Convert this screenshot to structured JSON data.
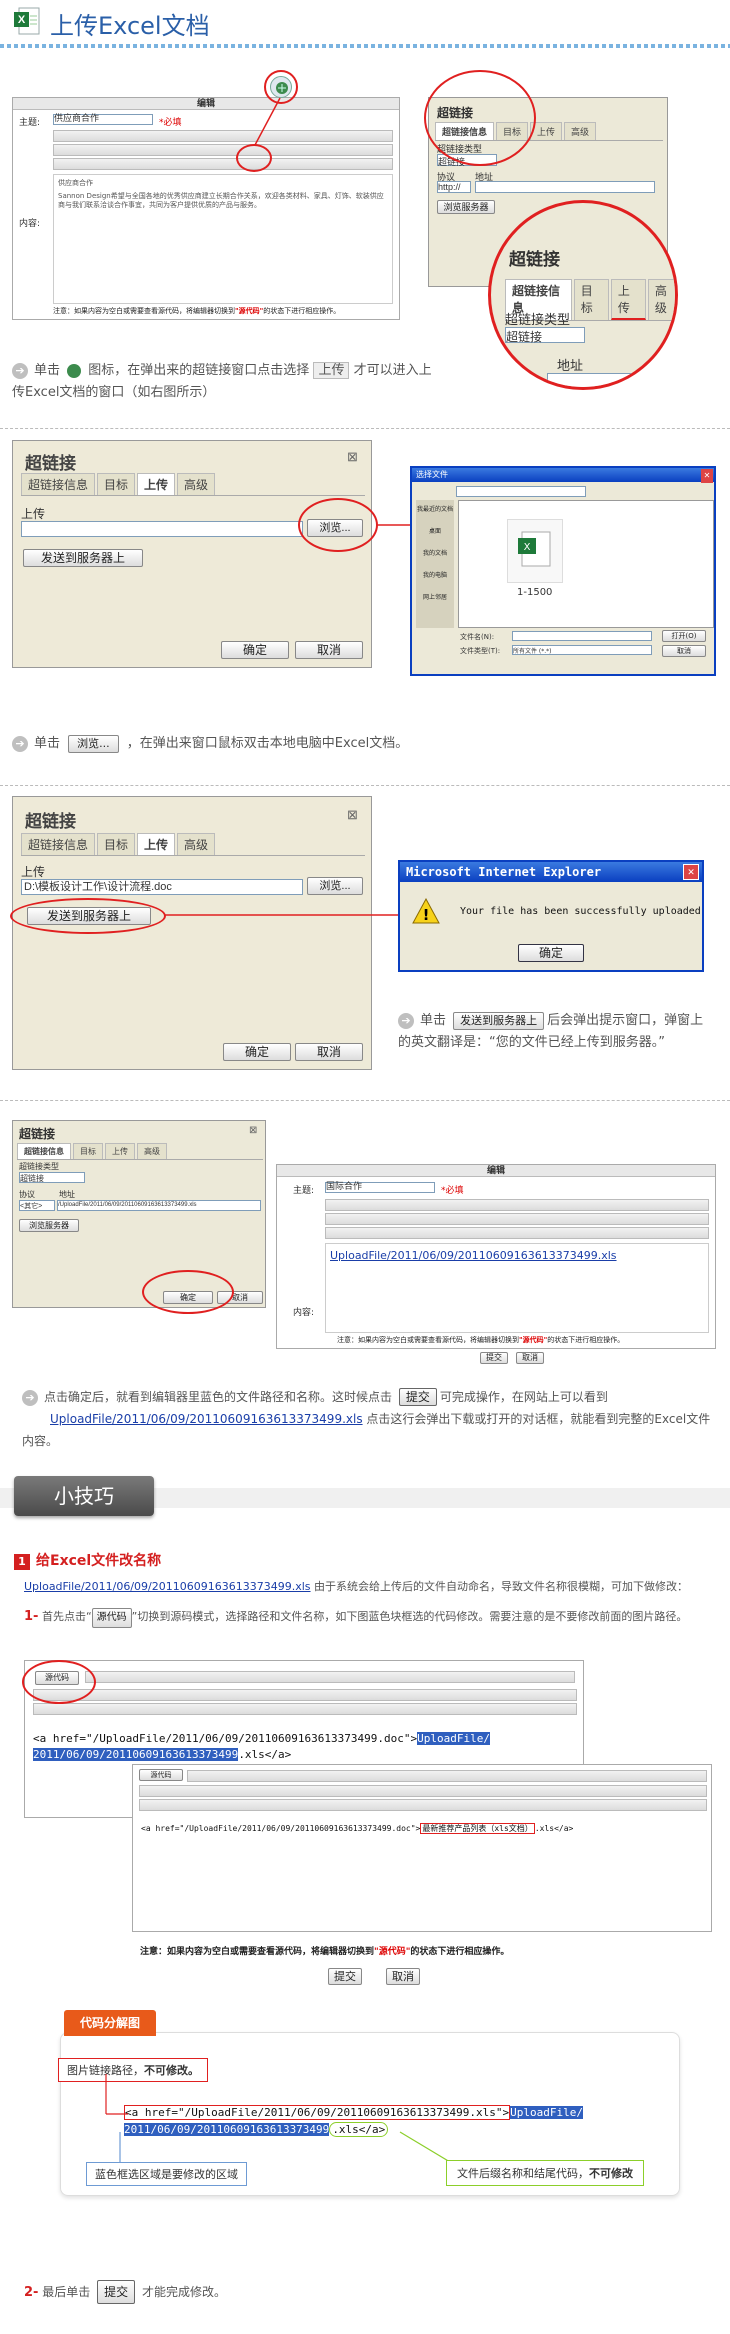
{
  "header": {
    "title": "上传Excel文档"
  },
  "step1": {
    "editor_title": "编辑",
    "subject_label": "主题:",
    "subject_value": "供应商合作",
    "required": "*必填",
    "content_label": "内容:",
    "body_title": "供应商合作",
    "body_text": "Sannon Design希望与全国各地的优秀供应商建立长期合作关系，欢迎各类材料、家具、灯饰、软装供应商与我们联系洽谈合作事宜，共同为客户提供优质的产品与服务。",
    "notice_prefix": "注意：如果内容为空白或需要查看源代码，将编辑器切换到",
    "notice_code": "\"源代码\"",
    "notice_suffix": "的状态下进行相应操作。",
    "hyperlink_title": "超链接",
    "tabs": [
      "超链接信息",
      "目标",
      "上传",
      "高级"
    ],
    "link_type_label": "超链接类型",
    "link_type_value": "超链接",
    "protocol_label": "协议",
    "protocol_value": "http://",
    "address_label": "地址",
    "browse_server": "浏览服务器",
    "desc_before": "单击",
    "desc_mid": "图标，在弹出来的超链接窗口点击选择",
    "desc_upload": "上传",
    "desc_after": "才可以进入上传Excel文档的窗口（如右图所示）"
  },
  "step2": {
    "title": "超链接",
    "tabs": [
      "超链接信息",
      "目标",
      "上传",
      "高级"
    ],
    "upload_label": "上传",
    "browse": "浏览...",
    "send": "发送到服务器上",
    "ok": "确定",
    "cancel": "取消",
    "file_dialog_title": "选择文件",
    "places": [
      "我最近的文档",
      "桌面",
      "我的文档",
      "我的电脑",
      "网上邻居"
    ],
    "file_name": "1-1500",
    "filename_label": "文件名(N):",
    "filetype_label": "文件类型(T):",
    "filetype_value": "所有文件 (*.*)",
    "open_btn": "打开(O)",
    "cancel_btn": "取消",
    "desc_before": "单击",
    "desc_btn": "浏览...",
    "desc_after": "，在弹出来窗口鼠标双击本地电脑中Excel文档。"
  },
  "step3": {
    "title": "超链接",
    "tabs": [
      "超链接信息",
      "目标",
      "上传",
      "高级"
    ],
    "upload_label": "上传",
    "path_value": "D:\\模板设计工作\\设计流程.doc",
    "browse": "浏览...",
    "send": "发送到服务器上",
    "ok": "确定",
    "cancel": "取消",
    "ie_title": "Microsoft Internet Explorer",
    "ie_message": "Your file has been successfully uploaded",
    "ie_ok": "确定",
    "desc_before": "单击",
    "desc_btn": "发送到服务器上",
    "desc_after": "后会弹出提示窗口，弹窗上的英文翻译是：“您的文件已经上传到服务器。”"
  },
  "step4": {
    "title": "超链接",
    "tabs": [
      "超链接信息",
      "目标",
      "上传",
      "高级"
    ],
    "link_type_label": "超链接类型",
    "link_type_value": "超链接",
    "protocol_label": "协议",
    "protocol_value": "<其它>",
    "address_label": "地址",
    "address_value": "/UploadFile/2011/06/09/20110609163613373499.xls",
    "browse_server": "浏览服务器",
    "ok": "确定",
    "cancel": "取消",
    "editor_title": "编辑",
    "subject_label": "主题:",
    "subject_value": "国际合作",
    "required": "*必填",
    "content_label": "内容:",
    "editor_link": "UploadFile/2011/06/09/20110609163613373499.xls",
    "notice_prefix": "注意：如果内容为空白或需要查看源代码，将编辑器切换到",
    "notice_code": "\"源代码\"",
    "notice_suffix": "的状态下进行相应操作。",
    "submit": "提交",
    "cancel2": "取消",
    "desc_1": "点击确定后，就看到编辑器里蓝色的文件路径和名称。这时候点击",
    "desc_submit": "提交",
    "desc_2": "可完成操作，在网站上可以看到",
    "desc_link": "UploadFile/2011/06/09/20110609163613373499.xls",
    "desc_3": "点击这行会弹出下载或打开的对话框，就能看到完整的Excel文件内容。"
  },
  "tips": {
    "banner": "小技巧",
    "num": "1",
    "heading": "给Excel文件改名称",
    "intro_link": "UploadFile/2011/06/09/20110609163613373499.xls",
    "intro_text": "由于系统会给上传后的文件自动命名，导致文件名称很模糊，可加下做修改：",
    "step1_num": "1-",
    "step1_a": "首先点击“",
    "step1_btn": "源代码",
    "step1_b": "”切换到源码模式，选择路径和文件名称，如下图蓝色块框选的代码修改。需要注意的是不要修改前面的图片路径。",
    "code_btn": "源代码",
    "code_line1_a": "<a href=\"/UploadFile/2011/06/09/20110609163613373499.doc\">",
    "code_line1_hl": "UploadFile/",
    "code_line2_hl": "2011/06/09/20110609163613373499",
    "code_line2_b": ".xls</a>",
    "code2_a": "<a href=\"/UploadFile/2011/06/09/20110609163613373499.doc\">",
    "code2_box": "最新推荐产品列表（xls文档）",
    "code2_b": ".xls</a>",
    "notice_prefix": "注意：如果内容为空白或需要查看源代码，将编辑器切换到",
    "notice_code": "\"源代码\"",
    "notice_suffix": "的状态下进行相应操作。",
    "submit": "提交",
    "cancel": "取消",
    "analysis_tab": "代码分解图",
    "img_path_note": "图片链接路径，",
    "img_path_bold": "不可修改。",
    "an_code_a": "<a href=\"/UploadFile/2011/06/09/20110609163613373499.xls\">",
    "an_code_hl1": "UploadFile/",
    "an_code_hl2": "2011/06/09/20110609163613373499",
    "an_code_b": ".xls</a>",
    "blue_note": "蓝色框选区域是要修改的区域",
    "suffix_note": "文件后缀名称和结尾代码，",
    "suffix_bold": "不可修改",
    "step2_num": "2-",
    "step2_a": "最后单击",
    "step2_btn": "提交",
    "step2_b": "才能完成修改。"
  }
}
